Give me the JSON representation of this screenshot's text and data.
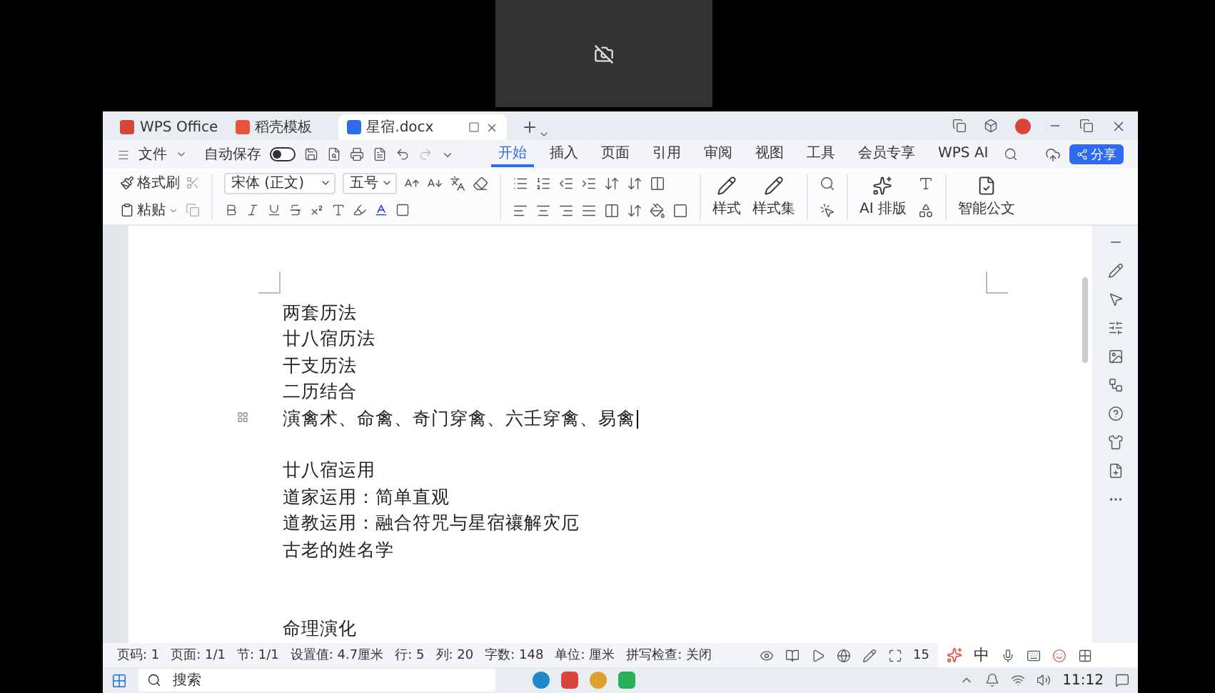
{
  "title_tabs": [
    {
      "label": "WPS Office",
      "kind": "home",
      "selected": false
    },
    {
      "label": "稻壳模板",
      "kind": "template",
      "selected": false
    },
    {
      "label": "星宿.docx",
      "kind": "document",
      "selected": true
    }
  ],
  "toolbar": {
    "file_menu": "文件",
    "autosave": {
      "label": "自动保存",
      "on": false
    },
    "menu_tabs": [
      {
        "label": "开始",
        "selected": true
      },
      {
        "label": "插入",
        "selected": false
      },
      {
        "label": "页面",
        "selected": false
      },
      {
        "label": "引用",
        "selected": false
      },
      {
        "label": "审阅",
        "selected": false
      },
      {
        "label": "视图",
        "selected": false
      },
      {
        "label": "工具",
        "selected": false
      },
      {
        "label": "会员专享",
        "selected": false
      },
      {
        "label": "WPS AI",
        "selected": false
      }
    ],
    "share": "分享"
  },
  "ribbon": {
    "format_painter": "格式刷",
    "paste": "粘贴",
    "font_name": "宋体 (正文)",
    "font_size": "五号",
    "styles": "样式",
    "style_sets": "样式集",
    "ai_layout": "AI 排版",
    "smart_document": "智能公文"
  },
  "document": {
    "sections": [
      {
        "lines": [
          {
            "text": "两套历法",
            "cursor": false
          },
          {
            "text": "廿八宿历法",
            "cursor": false
          },
          {
            "text": "干支历法",
            "cursor": false
          },
          {
            "text": "二历结合",
            "cursor": false
          },
          {
            "text": "演禽术、命禽、奇门穿禽、六壬穿禽、易禽",
            "cursor": true
          }
        ]
      },
      {
        "lines": [
          {
            "text": "廿八宿运用",
            "cursor": false
          },
          {
            "text": "道家运用：简单直观",
            "cursor": false
          },
          {
            "text": "道教运用：融合符咒与星宿禳解灾厄",
            "cursor": false
          },
          {
            "text": "古老的姓名学",
            "cursor": false
          }
        ]
      },
      {
        "lines": [
          {
            "text": "命理演化",
            "cursor": false
          }
        ]
      }
    ]
  },
  "status_bar": {
    "items": [
      "页码: 1",
      "页面: 1/1",
      "节: 1/1",
      "设置值: 4.7厘米",
      "行: 5",
      "列: 20",
      "字数: 148",
      "单位: 厘米",
      "拼写检查: 关闭"
    ],
    "zoom": "15"
  },
  "ime_bar": {
    "mode": "中"
  },
  "taskbar": {
    "search": {
      "placeholder": "搜索"
    },
    "time": "11:12"
  }
}
